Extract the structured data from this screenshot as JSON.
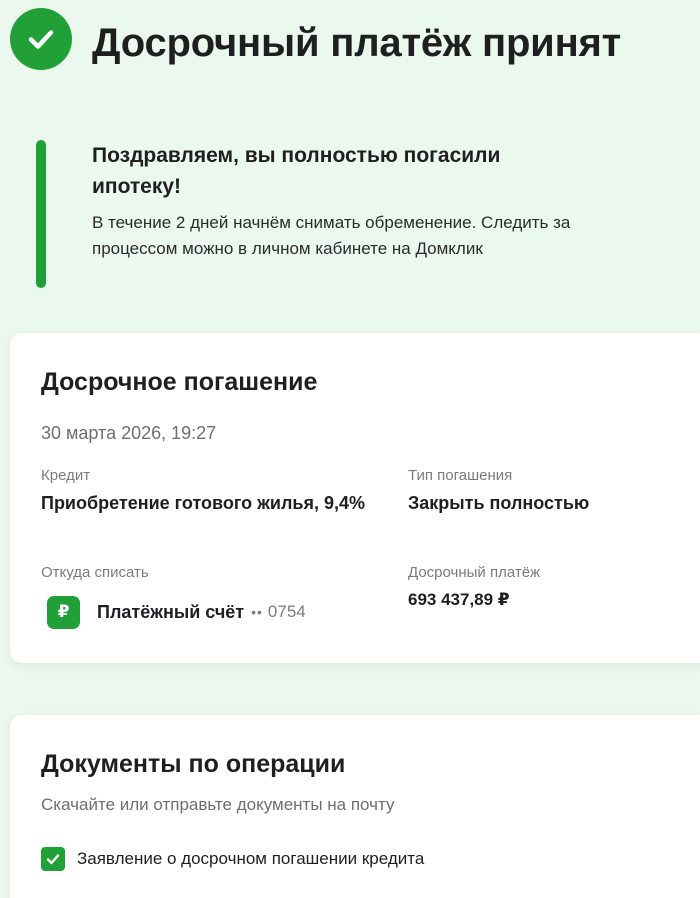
{
  "header": {
    "title": "Досрочный платёж принят",
    "icon": "check-circle-icon",
    "accent_color": "#21a038"
  },
  "congrats": {
    "title": "Поздравляем, вы полностью погасили ипотеку!",
    "text": "В течение 2 дней начнём снимать обременение. Следить за процессом можно в личном кабинете на Домклик"
  },
  "operation": {
    "title": "Досрочное погашение",
    "datetime": "30 марта 2026, 19:27",
    "credit": {
      "label": "Кредит",
      "value": "Приобретение готового жилья, 9,4%"
    },
    "repayment_type": {
      "label": "Тип погашения",
      "value": "Закрыть полностью"
    },
    "source": {
      "label": "Откуда списать",
      "icon": "ruble-icon",
      "icon_glyph": "₽",
      "account_name": "Платёжный счёт",
      "dots": "••",
      "account_mask": "0754"
    },
    "amount": {
      "label": "Досрочный платёж",
      "value": "693 437,89 ₽"
    }
  },
  "documents": {
    "title": "Документы по операции",
    "subtitle": "Скачайте или отправьте документы на почту",
    "items": [
      {
        "label": "Заявление о досрочном погашении кредита",
        "checked": true
      }
    ]
  }
}
